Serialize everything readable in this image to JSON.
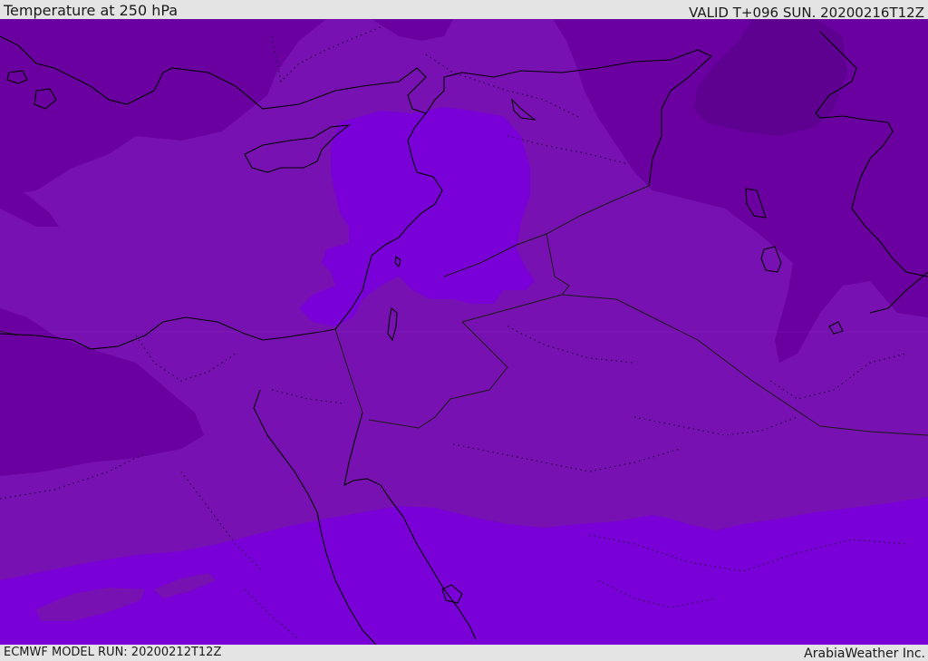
{
  "header": {
    "title": "Temperature at 250 hPa",
    "valid": "VALID T+096 SUN. 20200216T12Z"
  },
  "footer": {
    "model_run": "ECMWF MODEL RUN: 20200212T12Z",
    "credit": "ArabiaWeather Inc."
  },
  "map": {
    "fill_colors": {
      "coldest": "#5e0090",
      "cold": "#6a00a0",
      "medium": "#7811b1",
      "warm": "#7a00d8"
    },
    "line_colors": {
      "coastline": "#000000",
      "border": "#1a1a1a",
      "dotted_internal": "#2a0045"
    }
  }
}
